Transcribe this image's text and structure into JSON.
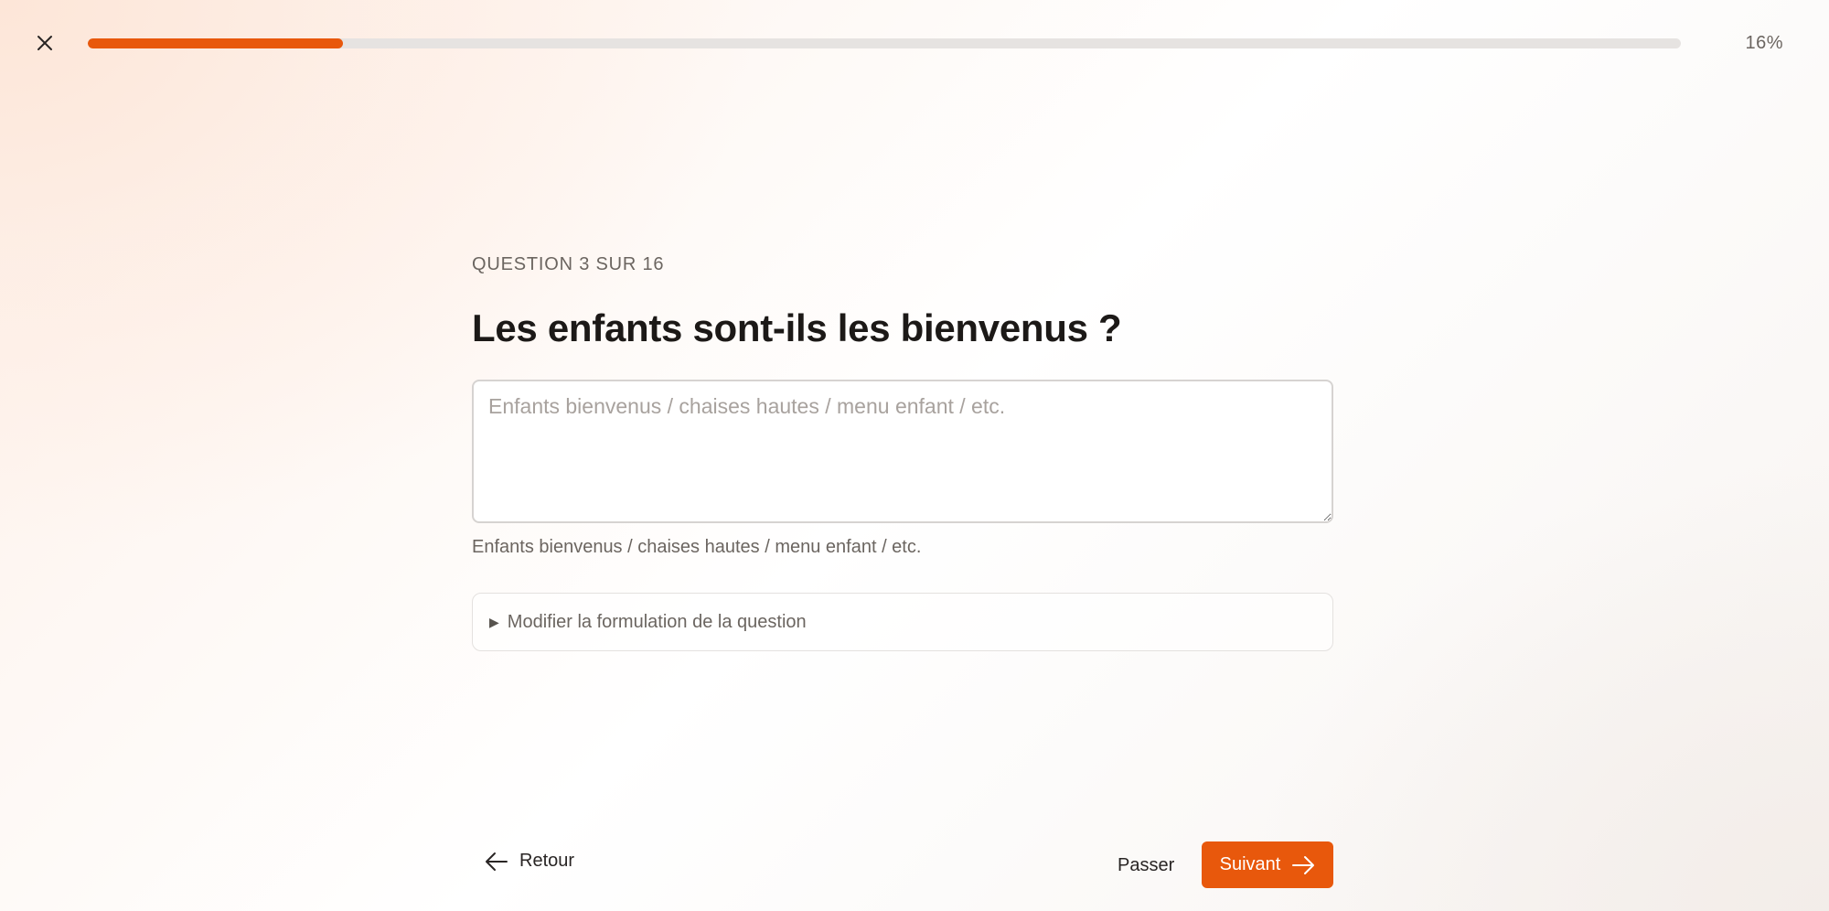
{
  "header": {
    "close_icon": "close-icon",
    "progress_fraction": 0.16,
    "progress_label": "16%"
  },
  "question": {
    "counter": "QUESTION 3 SUR 16",
    "title": "Les enfants sont-ils les bienvenus ?",
    "answer_value": "",
    "answer_placeholder": "Enfants bienvenus / chaises hautes / menu enfant / etc.",
    "hint": "Enfants bienvenus / chaises hautes / menu enfant / etc.",
    "rephrase_label": "Modifier la formulation de la question"
  },
  "footer": {
    "back_label": "Retour",
    "skip_label": "Passer",
    "next_label": "Suivant"
  },
  "colors": {
    "accent": "#e8580c",
    "track": "#e6e3e1"
  }
}
